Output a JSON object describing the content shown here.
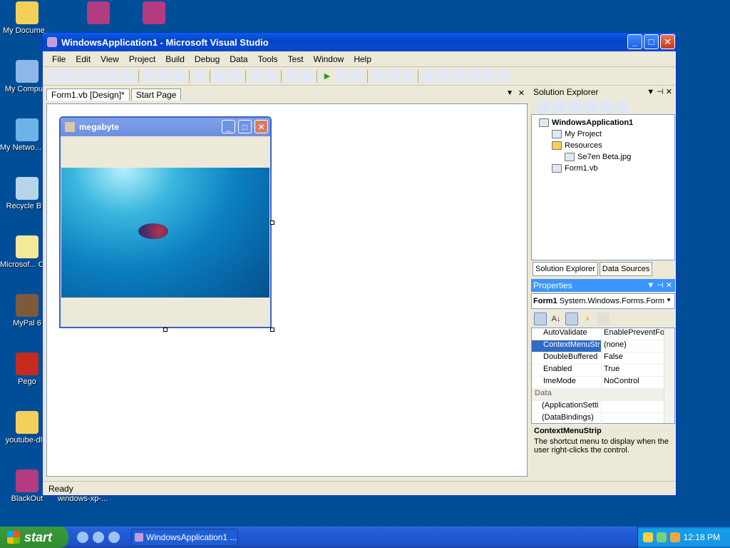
{
  "desktop": {
    "icons": [
      {
        "label": "My Docume...",
        "color": "#f4d05a"
      },
      {
        "label": "My Compu...",
        "color": "#8fb6e8"
      },
      {
        "label": "My Netwo... Places",
        "color": "#6db3e8"
      },
      {
        "label": "Recycle B...",
        "color": "#b6d6e8"
      },
      {
        "label": "Microsof... Outlook",
        "color": "#f6e89b"
      },
      {
        "label": "MyPal 6",
        "color": "#7d5a3c"
      },
      {
        "label": "Pego",
        "color": "#c52a1f"
      },
      {
        "label": "youtube-dl...",
        "color": "#f4d05a"
      },
      {
        "label": "BlackOut",
        "color": "#b33b82"
      },
      {
        "label": "windows-xp-...",
        "color": "#b33b82"
      }
    ]
  },
  "window": {
    "title": "WindowsApplication1 - Microsoft Visual Studio",
    "min": "_",
    "max": "□",
    "close": "✕"
  },
  "menu": [
    "File",
    "Edit",
    "View",
    "Project",
    "Build",
    "Debug",
    "Data",
    "Tools",
    "Test",
    "Window",
    "Help"
  ],
  "toolbar_icons": [
    "new-project-icon",
    "add-item-icon",
    "open-icon",
    "add-icon",
    "save-icon",
    "save-all-icon",
    "sep",
    "cut-icon",
    "copy-icon",
    "paste-icon",
    "sep",
    "find-icon",
    "sep",
    "comment-icon",
    "uncomment-icon",
    "sep",
    "undo-icon",
    "redo-icon",
    "sep",
    "navigate-back-icon",
    "navigate-forward-icon",
    "sep",
    "start-debug-icon",
    "pause-icon",
    "stop-icon",
    "sep",
    "step-into-icon",
    "step-over-icon",
    "step-out-icon",
    "sep",
    "solution-explorer-icon",
    "properties-icon",
    "object-browser-icon",
    "toolbox-icon",
    "error-list-icon",
    "command-window-icon"
  ],
  "tabs": [
    {
      "label": "Form1.vb [Design]*",
      "active": true
    },
    {
      "label": "Start Page",
      "active": false
    }
  ],
  "tab_controls": {
    "dropdown": "▼",
    "close": "✕"
  },
  "form": {
    "title": "megabyte",
    "min": "_",
    "max": "□",
    "close": "✕"
  },
  "solution_explorer": {
    "title": "Solution Explorer",
    "pin": "▼ ⊣ ✕",
    "tree": [
      {
        "label": "WindowsApplication1",
        "indent": 0,
        "bold": true
      },
      {
        "label": "My Project",
        "indent": 1,
        "bold": false
      },
      {
        "label": "Resources",
        "indent": 1,
        "bold": false
      },
      {
        "label": "Se7en Beta.jpg",
        "indent": 2,
        "bold": false
      },
      {
        "label": "Form1.vb",
        "indent": 1,
        "bold": false
      }
    ],
    "bottom_tabs": [
      "Solution Explorer",
      "Data Sources"
    ]
  },
  "properties": {
    "title": "Properties",
    "object": "Form1",
    "object_type": "System.Windows.Forms.Form",
    "rows": [
      {
        "name": "AutoValidate",
        "value": "EnablePreventFo",
        "type": "prop"
      },
      {
        "name": "ContextMenuStr",
        "value": "(none)",
        "type": "selected"
      },
      {
        "name": "DoubleBuffered",
        "value": "False",
        "type": "prop"
      },
      {
        "name": "Enabled",
        "value": "True",
        "type": "prop"
      },
      {
        "name": "ImeMode",
        "value": "NoControl",
        "type": "prop"
      },
      {
        "name": "Data",
        "value": "",
        "type": "category"
      },
      {
        "name": "(ApplicationSetti",
        "value": "",
        "type": "expand"
      },
      {
        "name": "(DataBindings)",
        "value": "",
        "type": "expand"
      }
    ],
    "desc_title": "ContextMenuStrip",
    "desc_text": "The shortcut menu to display when the user right-clicks the control."
  },
  "status": "Ready",
  "taskbar": {
    "start": "start",
    "task": "WindowsApplication1 ...",
    "clock": "12:18 PM"
  }
}
